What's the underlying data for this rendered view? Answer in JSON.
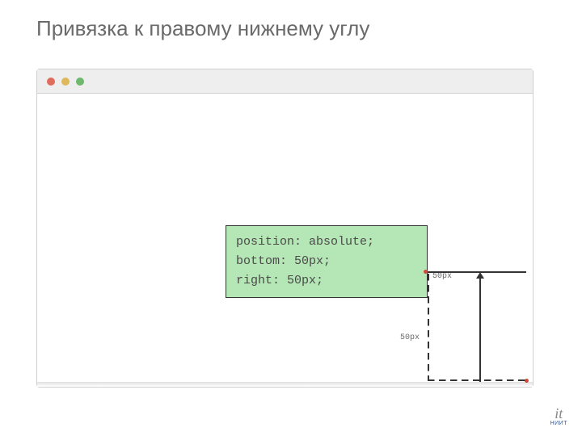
{
  "title": "Привязка к правому нижнему углу",
  "css": {
    "line1": "position: absolute;",
    "line2": "bottom: 50px;",
    "line3": "right: 50px;"
  },
  "labels": {
    "right_margin": "50px",
    "bottom_margin": "50px"
  },
  "logo": {
    "symbol": "it",
    "text": "НИИТ"
  }
}
